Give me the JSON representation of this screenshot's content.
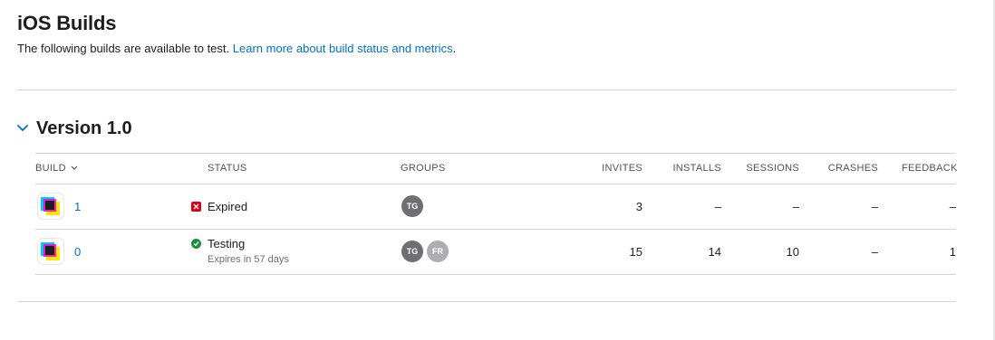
{
  "page": {
    "title": "iOS Builds",
    "subtitle_text": "The following builds are available to test.",
    "subtitle_link": "Learn more about build status and metrics",
    "subtitle_end": "."
  },
  "version": {
    "label": "Version 1.0",
    "expanded": true
  },
  "table": {
    "headers": {
      "build": "BUILD",
      "status": "STATUS",
      "groups": "GROUPS",
      "invites": "INVITES",
      "installs": "INSTALLS",
      "sessions": "SESSIONS",
      "crashes": "CRASHES",
      "feedback": "FEEDBACK"
    },
    "rows": [
      {
        "build": "1",
        "status": "Expired",
        "status_sub": "",
        "groups": [
          "TG"
        ],
        "invites": "3",
        "installs": "–",
        "sessions": "–",
        "crashes": "–",
        "feedback": "–"
      },
      {
        "build": "0",
        "status": "Testing",
        "status_sub": "Expires in 57 days",
        "groups": [
          "TG",
          "FR"
        ],
        "invites": "15",
        "installs": "14",
        "sessions": "10",
        "crashes": "–",
        "feedback": "1"
      }
    ]
  },
  "colors": {
    "link": "#0070c9",
    "expired": "#d70015",
    "testing": "#1e8e3e"
  },
  "icons": {
    "version_toggle": "chevron-down-icon",
    "sort": "chevron-down-icon",
    "expired": "x-square-icon",
    "testing": "checkmark-circle-icon",
    "app": "app-icon"
  }
}
